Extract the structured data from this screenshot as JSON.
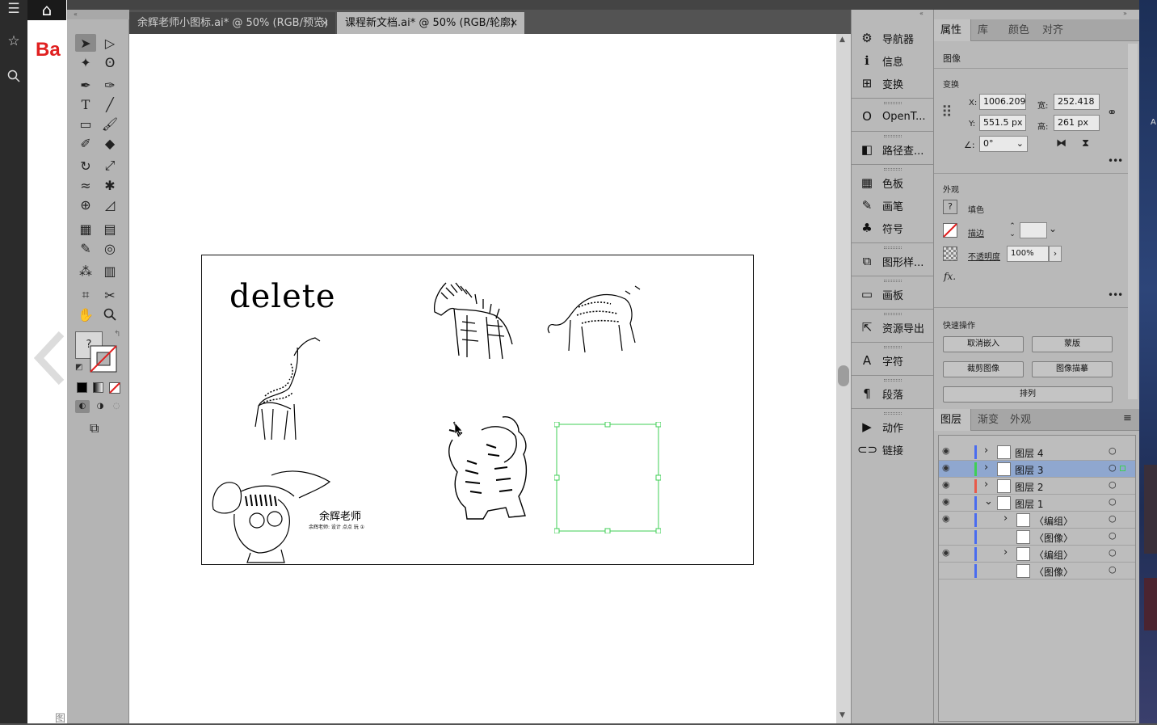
{
  "browser": {
    "icons": [
      "list-icon",
      "star-icon",
      "search-icon"
    ],
    "home_icon": "⌂",
    "logo_text": "Ba",
    "bottom_text": "图"
  },
  "tabs": [
    {
      "title": "余辉老师小图标.ai* @ 50% (RGB/预览)",
      "close": "×"
    },
    {
      "title": "课程新文档.ai* @ 50% (RGB/轮廓)",
      "close": "×"
    }
  ],
  "canvas": {
    "delete_text": "delete",
    "teacher_text": "余辉老师",
    "teacher_sub": "余辉老师: 设计 点点 玩 ①"
  },
  "dock": {
    "items": [
      {
        "icon": "⚙",
        "label": "导航器"
      },
      {
        "icon": "ℹ",
        "label": "信息"
      },
      {
        "icon": "⊞",
        "label": "变换"
      },
      {
        "icon": "O",
        "label": "OpenT..."
      },
      {
        "icon": "◧",
        "label": "路径查..."
      },
      {
        "icon": "▦",
        "label": "色板"
      },
      {
        "icon": "✎",
        "label": "画笔"
      },
      {
        "icon": "♣",
        "label": "符号"
      },
      {
        "icon": "⧉",
        "label": "图形样..."
      },
      {
        "icon": "▭",
        "label": "画板"
      },
      {
        "icon": "⇱",
        "label": "资源导出"
      },
      {
        "icon": "A",
        "label": "字符"
      },
      {
        "icon": "¶",
        "label": "段落"
      },
      {
        "icon": "▶",
        "label": "动作"
      },
      {
        "icon": "⊂⊃",
        "label": "链接"
      }
    ]
  },
  "properties": {
    "tabs": [
      "属性",
      "库",
      "颜色",
      "对齐"
    ],
    "selection_type": "图像",
    "transform_title": "变换",
    "x_label": "X:",
    "x_value": "1006.209",
    "y_label": "Y:",
    "y_value": "551.5 px",
    "w_label": "宽:",
    "w_value": "252.418",
    "h_label": "高:",
    "h_value": "261 px",
    "angle_label": "∠:",
    "angle_value": "0°",
    "more": "•••",
    "appearance_title": "外观",
    "fill_label": "填色",
    "stroke_label": "描边",
    "opacity_label": "不透明度",
    "opacity_value": "100%",
    "fx_label": "fx.",
    "quick_title": "快速操作",
    "btn_unembed": "取消嵌入",
    "btn_mask": "蒙版",
    "btn_crop": "裁剪图像",
    "btn_trace": "图像描摹",
    "btn_arrange": "排列"
  },
  "layers_panel": {
    "tabs": [
      "图层",
      "渐变",
      "外观"
    ],
    "menu_icon": "≡",
    "rows": [
      {
        "name": "图层 4",
        "eye": "◉",
        "color": "#4a6cf0",
        "expand": "›"
      },
      {
        "name": "图层 3",
        "eye": "◉",
        "color": "#3fcf55",
        "expand": "›"
      },
      {
        "name": "图层 2",
        "eye": "◉",
        "color": "#e85a4a",
        "expand": "›"
      },
      {
        "name": "图层 1",
        "eye": "◉",
        "color": "#4a6cf0",
        "expand": "⌄"
      },
      {
        "name": "〈编组〉",
        "eye": "◉",
        "color": "#4a6cf0",
        "expand": "›"
      },
      {
        "name": "〈图像〉",
        "eye": "",
        "color": "#4a6cf0",
        "expand": ""
      },
      {
        "name": "〈编组〉",
        "eye": "◉",
        "color": "#4a6cf0",
        "expand": "›"
      },
      {
        "name": "〈图像〉",
        "eye": "",
        "color": "#4a6cf0",
        "expand": ""
      }
    ],
    "target_icon": "○"
  },
  "colors": {
    "selection_green": "#3fcf55",
    "selected_row": "#8fa7cf",
    "baidu_red": "#e02020"
  }
}
